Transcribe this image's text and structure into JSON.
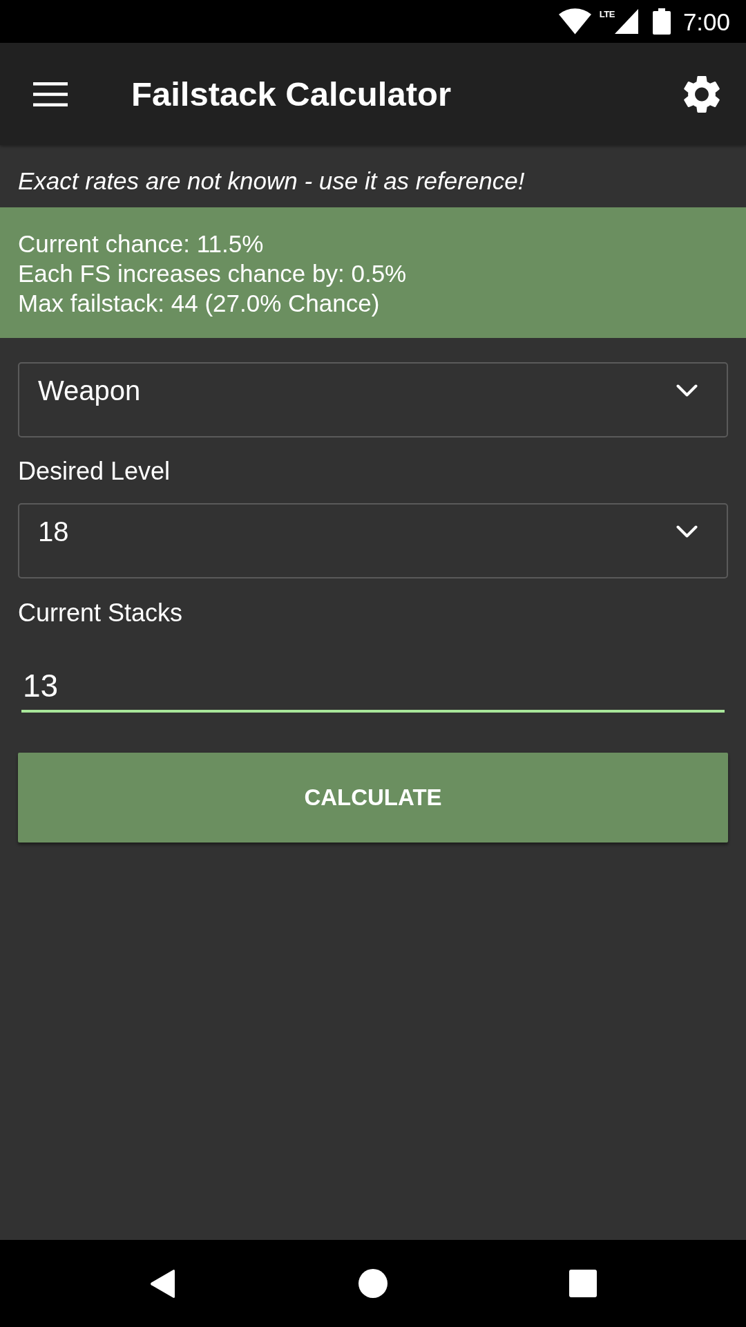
{
  "status_bar": {
    "network": "LTE",
    "time": "7:00"
  },
  "app_bar": {
    "title": "Failstack Calculator"
  },
  "notice": "Exact rates are not known - use it as reference!",
  "summary": [
    "Current chance: 11.5%",
    "Each FS increases chance by: 0.5%",
    "Max failstack: 44 (27.0% Chance)"
  ],
  "form": {
    "fields": [
      {
        "kind": "dropdown",
        "value": "Weapon"
      },
      {
        "kind": "dropdown",
        "label": "Desired Level",
        "value": "18"
      },
      {
        "kind": "text",
        "label": "Current Stacks",
        "value": "13",
        "focused": true
      }
    ]
  },
  "button": {
    "label": "CALCULATE"
  }
}
